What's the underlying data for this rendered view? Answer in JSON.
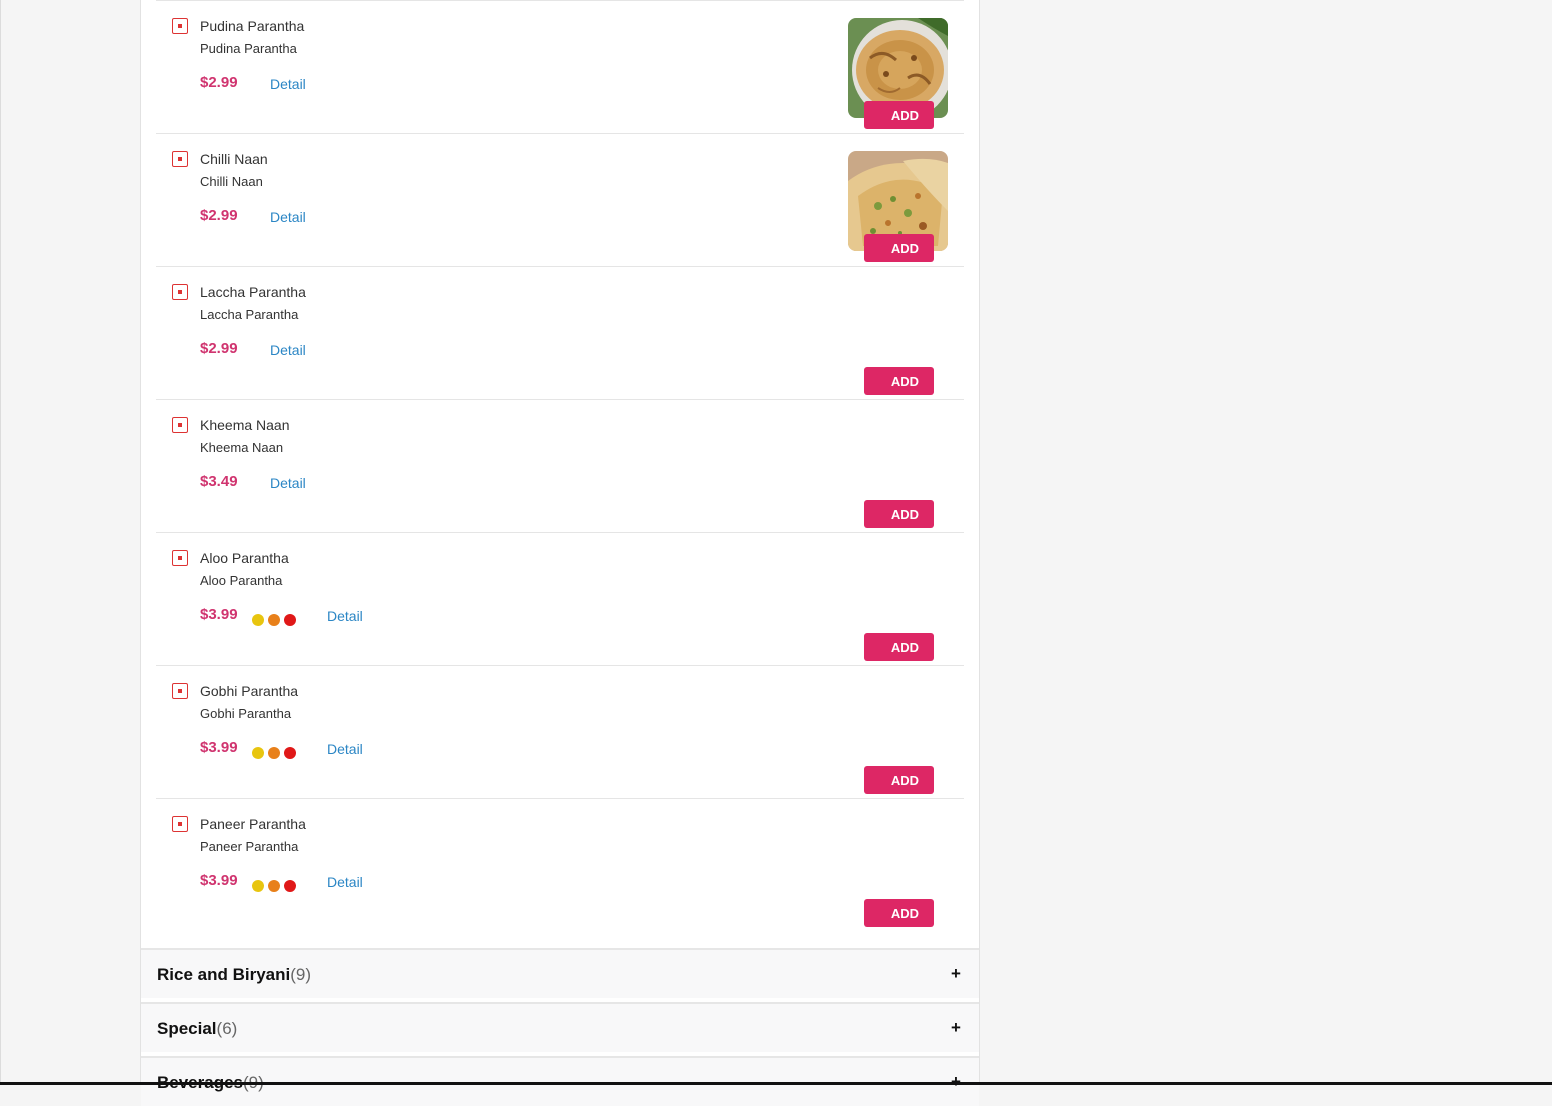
{
  "menu_items": [
    {
      "name": "Pudina Parantha",
      "description": "Pudina Parantha",
      "price": "$2.99",
      "spice_level": 0,
      "detail_label": "Detail",
      "add_label": "ADD",
      "image": "pudina-parantha-photo"
    },
    {
      "name": "Chilli Naan",
      "description": "Chilli Naan",
      "price": "$2.99",
      "spice_level": 0,
      "detail_label": "Detail",
      "add_label": "ADD",
      "image": "chilli-naan-photo"
    },
    {
      "name": "Laccha Parantha",
      "description": "Laccha Parantha",
      "price": "$2.99",
      "spice_level": 0,
      "detail_label": "Detail",
      "add_label": "ADD"
    },
    {
      "name": "Kheema Naan",
      "description": "Kheema Naan",
      "price": "$3.49",
      "spice_level": 0,
      "detail_label": "Detail",
      "add_label": "ADD"
    },
    {
      "name": "Aloo Parantha",
      "description": "Aloo Parantha",
      "price": "$3.99",
      "spice_level": 3,
      "detail_label": "Detail",
      "add_label": "ADD"
    },
    {
      "name": "Gobhi Parantha",
      "description": "Gobhi Parantha",
      "price": "$3.99",
      "spice_level": 3,
      "detail_label": "Detail",
      "add_label": "ADD"
    },
    {
      "name": "Paneer Parantha",
      "description": "Paneer Parantha",
      "price": "$3.99",
      "spice_level": 3,
      "detail_label": "Detail",
      "add_label": "ADD"
    }
  ],
  "spice_colors": [
    "#e8c50f",
    "#e8801a",
    "#e01818"
  ],
  "categories": [
    {
      "title": "Rice and Biryani",
      "count": "(9)",
      "toggle": "+"
    },
    {
      "title": "Special",
      "count": "(6)",
      "toggle": "+"
    },
    {
      "title": "Beverages",
      "count": "(9)",
      "toggle": "+"
    }
  ],
  "colors": {
    "price": "#d0346f",
    "add_button": "#dd2765",
    "detail_link": "#2b86c5",
    "veg_mark": "#dd3333"
  },
  "icons": {
    "veg_indicator": "veg-indicator-icon",
    "expand": "plus-icon"
  }
}
